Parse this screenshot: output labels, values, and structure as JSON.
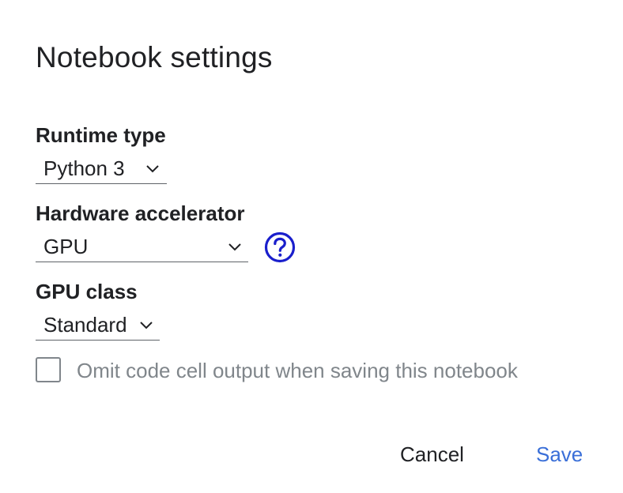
{
  "dialog": {
    "title": "Notebook settings",
    "runtime": {
      "label": "Runtime type",
      "selected": "Python 3"
    },
    "accelerator": {
      "label": "Hardware accelerator",
      "selected": "GPU",
      "help_icon": "help-circle-icon"
    },
    "gpu_class": {
      "label": "GPU class",
      "selected": "Standard"
    },
    "omit_output": {
      "label": "Omit code cell output when saving this notebook",
      "checked": false
    },
    "buttons": {
      "cancel": "Cancel",
      "save": "Save"
    }
  },
  "colors": {
    "accent": "#3a6fd8",
    "help_icon": "#1a1fcc",
    "text": "#202124",
    "muted": "#80868b"
  }
}
